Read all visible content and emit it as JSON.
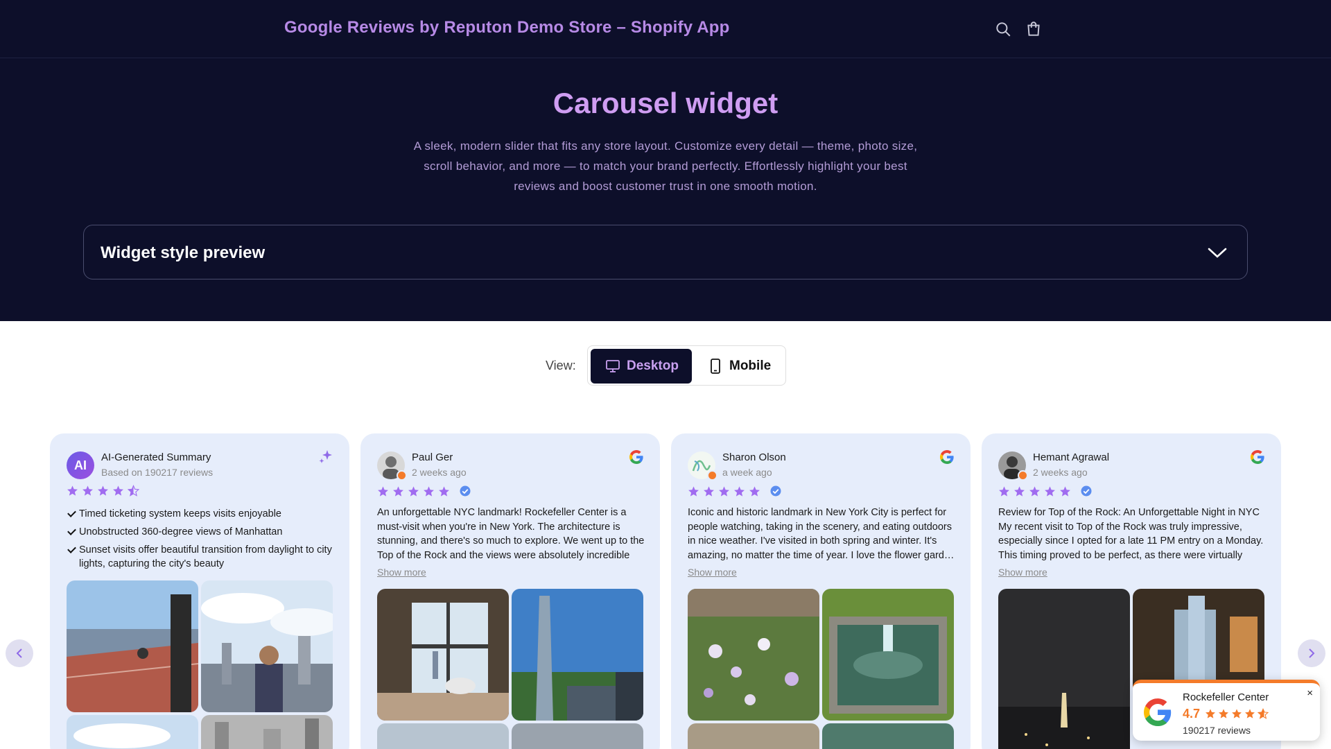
{
  "header": {
    "store_title": "Google Reviews by Reputon Demo Store – Shopify App"
  },
  "hero": {
    "title": "Carousel widget",
    "description": "A sleek, modern slider that fits any store layout. Customize every detail — theme, photo size, scroll behavior, and more — to match your brand perfectly. Effortlessly highlight your best reviews and boost customer trust in one smooth motion.",
    "preview_label": "Widget style preview"
  },
  "view_toggle": {
    "label": "View:",
    "options": [
      "Desktop",
      "Mobile"
    ],
    "selected": "Desktop"
  },
  "cards": [
    {
      "type": "ai-summary",
      "avatar_initials": "AI",
      "title": "AI-Generated Summary",
      "subtitle": "Based on 190217 reviews",
      "rating": 4.5,
      "points": [
        "Timed ticketing system keeps visits enjoyable",
        "Unobstructed 360-degree views of Manhattan",
        "Sunset visits offer beautiful transition from daylight to city lights, capturing the city's beauty"
      ]
    },
    {
      "type": "review",
      "name": "Paul Ger",
      "date": "2 weeks ago",
      "rating": 5,
      "text": "An unforgettable NYC landmark! Rockefeller Center is a must-visit when you're in New York. The architecture is stunning, and there's so much to explore. We went up to the Top of the Rock and the views were absolutely incredible—…",
      "show_more": "Show more"
    },
    {
      "type": "review",
      "name": "Sharon Olson",
      "date": "a week ago",
      "rating": 5,
      "text": "Iconic and historic landmark in New York City is perfect for people watching, taking in the scenery, and eating outdoors in nice weather. I've visited in both spring and winter. It's amazing, no matter the time of year. I love the flower gard…",
      "show_more": "Show more"
    },
    {
      "type": "review",
      "name": "Hemant Agrawal",
      "date": "2 weeks ago",
      "rating": 5,
      "text": "Review for Top of the Rock: An Unforgettable Night in NYC My recent visit to Top of the Rock was truly impressive, especially since I opted for a late 11 PM entry on a Monday. This timing proved to be perfect, as there were virtually no…",
      "show_more": "Show more"
    }
  ],
  "rating_badge": {
    "place_name": "Rockefeller Center",
    "rating": "4.7",
    "rating_value": 4.7,
    "reviews_count": "190217 reviews",
    "close_symbol": "×"
  },
  "colors": {
    "header_bg": "#0d0f2a",
    "accent_purple": "#b78ae6",
    "star_purple": "#a06cf0",
    "card_bg": "#e6edfb",
    "badge_orange": "#f47b2a"
  },
  "icons": [
    "search-icon",
    "cart-icon",
    "chevron-down-icon",
    "desktop-icon",
    "mobile-icon",
    "sparkle-icon",
    "google-icon",
    "verified-icon",
    "star-icon",
    "chevron-left-icon",
    "chevron-right-icon",
    "close-icon"
  ]
}
